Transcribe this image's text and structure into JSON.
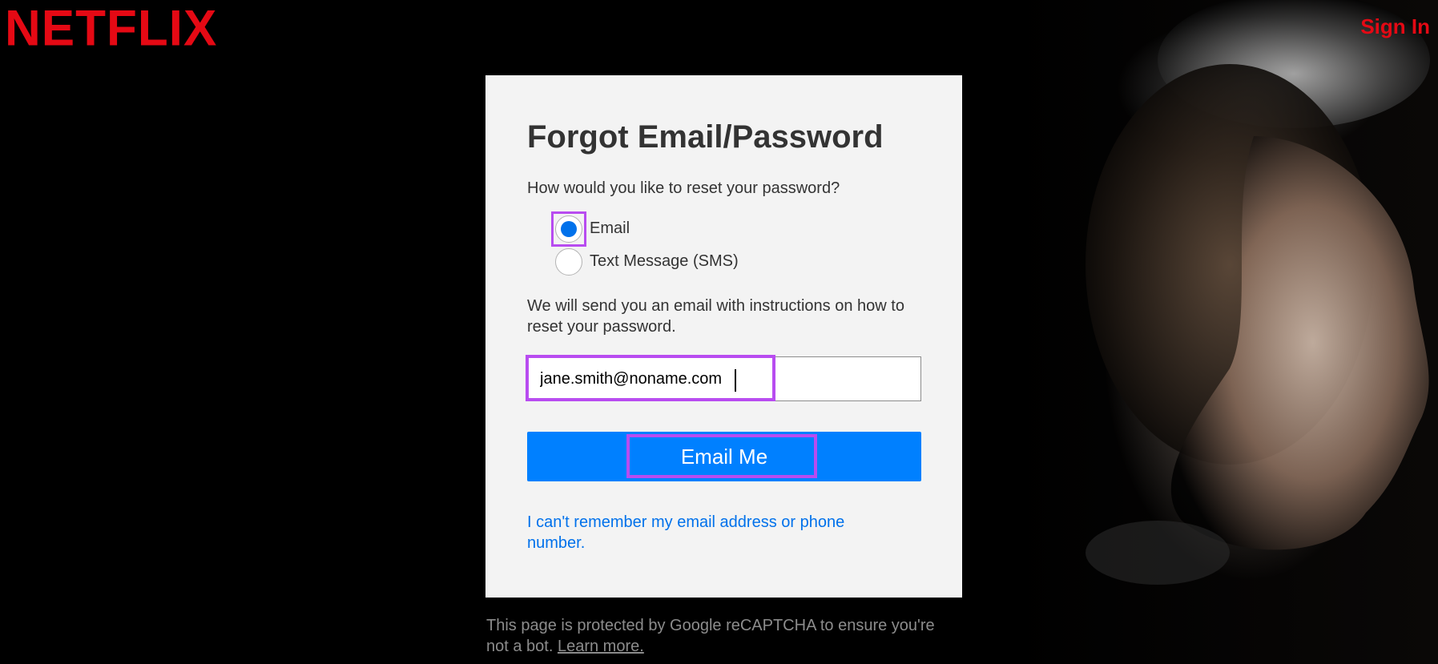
{
  "header": {
    "logo_text": "NETFLIX",
    "sign_in_label": "Sign In"
  },
  "form": {
    "title": "Forgot Email/Password",
    "question": "How would you like to reset your password?",
    "options": [
      {
        "label": "Email",
        "selected": true
      },
      {
        "label": "Text Message (SMS)",
        "selected": false
      }
    ],
    "instructions": "We will send you an email with instructions on how to reset your password.",
    "email_value": "jane.smith@noname.com",
    "submit_label": "Email Me",
    "help_link": "I can't remember my email address or phone number."
  },
  "footer": {
    "recaptcha_text": "This page is protected by Google reCAPTCHA to ensure you're not a bot.",
    "learn_more": "Learn more."
  },
  "colors": {
    "brand": "#e50914",
    "button": "#0080ff",
    "link": "#0071eb",
    "highlight": "#b84cf0"
  }
}
